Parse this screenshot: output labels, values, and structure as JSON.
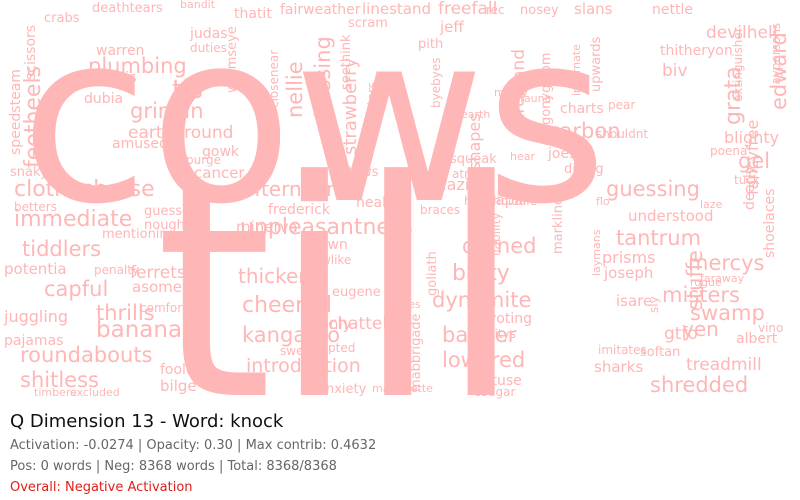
{
  "colors": {
    "word": "#ffb6b6",
    "overall": "#e0201c",
    "stats": "#666666"
  },
  "header": {
    "title": "Q Dimension 13 - Word: knock"
  },
  "stats": {
    "line1": "Activation: -0.0274 | Opacity: 0.30 | Max contrib: 0.4632",
    "line2": "Pos: 0 words | Neg: 8368 words | Total: 8368/8368",
    "overall": "Overall: Negative Activation"
  },
  "cloud": {
    "words": [
      "cows",
      "till",
      "afternoon",
      "unpleasantness",
      "clotheshorse",
      "immediate",
      "tiddlers",
      "capful",
      "bananas",
      "roundabouts",
      "shitless",
      "thrills",
      "kangaroo",
      "cheerful",
      "thickens",
      "introduction",
      "dynamite",
      "babber",
      "lowered",
      "durned",
      "batty",
      "guessing",
      "tantrum",
      "mercys",
      "shredded",
      "misters",
      "swamp",
      "carbon",
      "gel",
      "grata",
      "edward",
      "plumbing",
      "grinnin",
      "tis",
      "feetheels",
      "nellie",
      "dressing",
      "strawberry",
      "shapes",
      "arestand",
      "agonygloom",
      "biv",
      "blighty",
      "fancyfree",
      "yen",
      "stuffe",
      "treadmill",
      "albert",
      "prisms",
      "joseph",
      "isare",
      "gtfo",
      "softan",
      "sharks",
      "imitates",
      "juggling",
      "pajamas",
      "potentia",
      "ferrets",
      "asome",
      "comforter",
      "bilge",
      "fooled",
      "excluded",
      "timbers",
      "anxiety",
      "chattels",
      "plainly",
      "excepted",
      "gown",
      "howlike",
      "eugene",
      "voting",
      "citys",
      "obtuse",
      "cougar",
      "honcho",
      "papa",
      "louie",
      "blazing",
      "squeak",
      "atnear",
      "diving",
      "joes",
      "minerva",
      "frederick",
      "cancer",
      "purge",
      "gowk",
      "amused",
      "earthground",
      "skis",
      "dubia",
      "warren",
      "judas",
      "duties",
      "thatit",
      "deathtears",
      "crabs",
      "fairweather",
      "linestand",
      "freefall",
      "slans",
      "nettle",
      "devilhell",
      "thitheryon",
      "extinguisher",
      "laypersons",
      "charts",
      "pear",
      "fauna",
      "upwards",
      "incarnate",
      "understood",
      "dearly",
      "shoelaces",
      "guessed",
      "nought",
      "mentioning",
      "betters",
      "snaky",
      "speedsteam",
      "scissors",
      "wormseye",
      "closenear",
      "seethink",
      "scram",
      "jeff",
      "pith",
      "byebyes",
      "tatters",
      "taws",
      "heal",
      "braces",
      "mabbrigade",
      "goliath",
      "liability",
      "markline",
      "laymans",
      "sly",
      "penalty",
      "vino",
      "shouldnt",
      "poena",
      "tuck",
      "dearth",
      "manly",
      "flo",
      "laze",
      "faraway",
      "hear",
      "rec",
      "nosey",
      "bandit",
      "rogue",
      "sweep",
      "twos",
      "judders",
      "lilies",
      "marionette"
    ]
  }
}
